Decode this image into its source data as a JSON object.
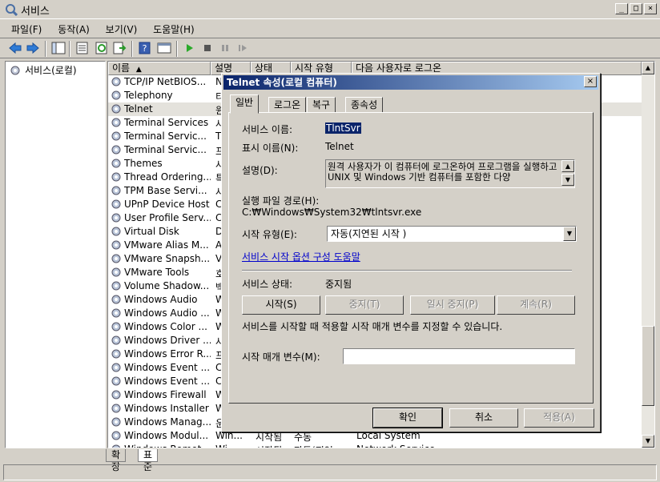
{
  "window": {
    "title": "서비스",
    "min": "_",
    "max": "□",
    "close": "×"
  },
  "menu": [
    "파일(F)",
    "동작(A)",
    "보기(V)",
    "도움말(H)"
  ],
  "tree": {
    "root": "서비스(로컬)"
  },
  "columns": [
    "이름",
    "설명",
    "상태",
    "시작 유형",
    "다음 사용자로 로그온"
  ],
  "rows": [
    {
      "name": "TCP/IP NetBIOS...",
      "desc": "N"
    },
    {
      "name": "Telephony",
      "desc": "티"
    },
    {
      "name": "Telnet",
      "desc": "원"
    },
    {
      "name": "Terminal Services",
      "desc": "사"
    },
    {
      "name": "Terminal Servic...",
      "desc": "T"
    },
    {
      "name": "Terminal Servic...",
      "desc": "프"
    },
    {
      "name": "Themes",
      "desc": "사"
    },
    {
      "name": "Thread Ordering...",
      "desc": "특"
    },
    {
      "name": "TPM Base Servi...",
      "desc": "사"
    },
    {
      "name": "UPnP Device Host",
      "desc": "C"
    },
    {
      "name": "User Profile Serv...",
      "desc": "C"
    },
    {
      "name": "Virtual Disk",
      "desc": "D"
    },
    {
      "name": "VMware Alias M...",
      "desc": "A"
    },
    {
      "name": "VMware Snapsh...",
      "desc": "V"
    },
    {
      "name": "VMware Tools",
      "desc": "호"
    },
    {
      "name": "Volume Shadow...",
      "desc": "백"
    },
    {
      "name": "Windows Audio",
      "desc": "W"
    },
    {
      "name": "Windows Audio ...",
      "desc": "W"
    },
    {
      "name": "Windows Color ...",
      "desc": "W"
    },
    {
      "name": "Windows Driver ...",
      "desc": "사"
    },
    {
      "name": "Windows Error R...",
      "desc": "프"
    },
    {
      "name": "Windows Event ...",
      "desc": "C"
    },
    {
      "name": "Windows Event ...",
      "desc": "C"
    },
    {
      "name": "Windows Firewall",
      "desc": "W"
    },
    {
      "name": "Windows Installer",
      "desc": "W"
    },
    {
      "name": "Windows Manag...",
      "desc": "운"
    },
    {
      "name": "Windows Modul...",
      "desc": "Win...",
      "state": "시작됨",
      "type": "수동",
      "logon": "Local System"
    },
    {
      "name": "Windows Remot...",
      "desc": "Wi...",
      "state": "시작됨",
      "type": "자동(지연...",
      "logon": "Network Service"
    }
  ],
  "bottom_tabs": [
    "확장",
    "표준"
  ],
  "dialog": {
    "title": "Telnet 속성(로컬 컴퓨터)",
    "close": "×",
    "tabs": [
      "일반",
      "로그온",
      "복구",
      "종속성"
    ],
    "service_name_label": "서비스 이름:",
    "service_name": "TlntSvr",
    "display_name_label": "표시 이름(N):",
    "display_name": "Telnet",
    "desc_label": "설명(D):",
    "description": "원격 사용자가 이 컴퓨터에 로그온하여 프로그램을 실행하고 UNIX 및 Windows 기반 컴퓨터를 포함한 다양",
    "path_label": "실행 파일 경로(H):",
    "path": "C:₩Windows₩System32₩tlntsvr.exe",
    "startup_label": "시작 유형(E):",
    "startup_value": "자동(지연된 시작 )",
    "help_link": "서비스 시작 옵션 구성 도움말",
    "status_label": "서비스 상태:",
    "status_value": "중지됨",
    "btn_start": "시작(S)",
    "btn_stop": "중지(T)",
    "btn_pause": "일시 중지(P)",
    "btn_resume": "계속(R)",
    "params_hint": "서비스를 시작할 때 적용할 시작 매개 변수를 지정할 수 있습니다.",
    "params_label": "시작 매개 변수(M):",
    "params_value": "",
    "btn_ok": "확인",
    "btn_cancel": "취소",
    "btn_apply": "적용(A)"
  }
}
